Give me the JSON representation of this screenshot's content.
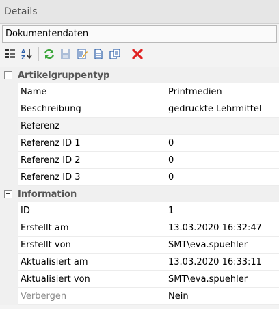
{
  "panel": {
    "title": "Details"
  },
  "selector": {
    "value": "Dokumentendaten"
  },
  "toolbar": {
    "icons": [
      "categorized-view-icon",
      "alphabetical-sort-icon",
      "refresh-icon",
      "save-icon",
      "edit-icon",
      "new-document-icon",
      "copy-icon",
      "delete-icon"
    ],
    "colors": {
      "refresh": "#3aa63a",
      "delete": "#e02020",
      "doc": "#2b5ea8"
    }
  },
  "grid": {
    "categories": [
      {
        "title": "Artikelgruppentyp",
        "rows": [
          {
            "name": "Name",
            "value": "Printmedien"
          },
          {
            "name": "Beschreibung",
            "value": "gedruckte Lehrmittel"
          },
          {
            "name": "Referenz",
            "value": ""
          },
          {
            "name": "Referenz ID 1",
            "value": "0"
          },
          {
            "name": "Referenz ID 2",
            "value": "0"
          },
          {
            "name": "Referenz ID 3",
            "value": "0"
          }
        ]
      },
      {
        "title": "Information",
        "rows": [
          {
            "name": "ID",
            "value": "1"
          },
          {
            "name": "Erstellt am",
            "value": "13.03.2020 16:32:47"
          },
          {
            "name": "Erstellt von",
            "value": "SMT\\eva.spuehler"
          },
          {
            "name": "Aktualisiert am",
            "value": "13.03.2020 16:33:11"
          },
          {
            "name": "Aktualisiert von",
            "value": "SMT\\eva.spuehler"
          },
          {
            "name": "Verbergen",
            "value": "Nein"
          }
        ]
      }
    ]
  }
}
